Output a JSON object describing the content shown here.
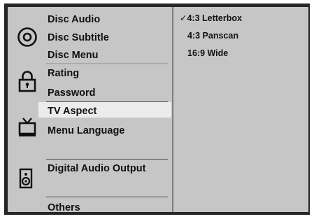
{
  "menu": {
    "groups": [
      {
        "icon": "disc-icon",
        "items": [
          "Disc Audio",
          "Disc Subtitle",
          "Disc Menu"
        ]
      },
      {
        "icon": "padlock-icon",
        "items": [
          "Rating",
          "Password"
        ]
      },
      {
        "icon": "tv-icon",
        "items": [
          "TV Aspect",
          "Menu Language"
        ]
      },
      {
        "icon": "speaker-icon",
        "items": [
          "Digital Audio Output"
        ]
      },
      {
        "icon": "",
        "items": [
          "Others"
        ]
      }
    ],
    "selected_item": "TV Aspect"
  },
  "options": {
    "check_mark": "✓",
    "items": [
      "4:3 Letterbox",
      "4:3 Panscan",
      "16:9 Wide"
    ],
    "selected_index": 0
  },
  "colors": {
    "panel": "#c6c6c6",
    "highlight": "#ececec",
    "frame": "#262626",
    "text": "#111111"
  }
}
